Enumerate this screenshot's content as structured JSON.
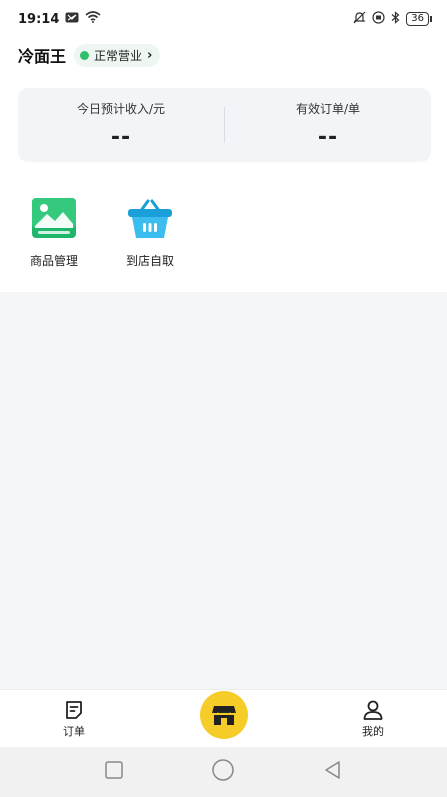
{
  "status_bar": {
    "time": "19:14",
    "battery": "36"
  },
  "header": {
    "shop_name": "冷面王",
    "status_label": "正常营业",
    "status_color": "#2fbf6a"
  },
  "stats": [
    {
      "label": "今日预计收入/元",
      "value": "--"
    },
    {
      "label": "有效订单/单",
      "value": "--"
    }
  ],
  "quick_actions": [
    {
      "label": "商品管理",
      "icon": "product-image-icon"
    },
    {
      "label": "到店自取",
      "icon": "shopping-basket-icon"
    }
  ],
  "tab_bar": {
    "orders_label": "订单",
    "mine_label": "我的",
    "accent_color": "#f6cc29"
  }
}
